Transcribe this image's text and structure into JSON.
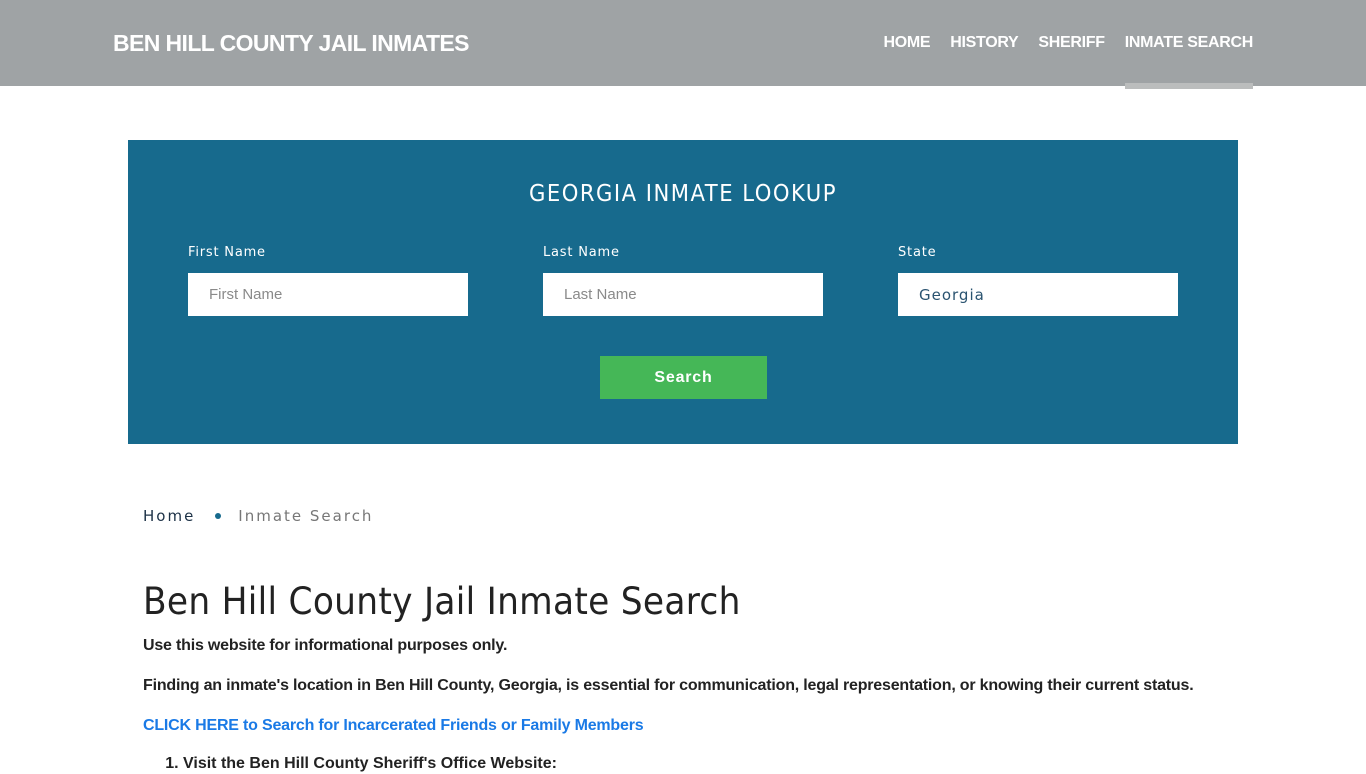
{
  "header": {
    "brand": "BEN HILL COUNTY JAIL INMATES",
    "nav": [
      {
        "label": "HOME",
        "active": false
      },
      {
        "label": "HISTORY",
        "active": false
      },
      {
        "label": "SHERIFF",
        "active": false
      },
      {
        "label": "INMATE SEARCH",
        "active": true
      }
    ],
    "colors": {
      "background": "#9fa3a5",
      "active_underline": "#bbbdbd"
    }
  },
  "lookup": {
    "title": "GEORGIA INMATE LOOKUP",
    "first_name": {
      "label": "First Name",
      "placeholder": "First Name",
      "value": ""
    },
    "last_name": {
      "label": "Last Name",
      "placeholder": "Last Name",
      "value": ""
    },
    "state": {
      "label": "State",
      "value": "Georgia"
    },
    "search_button": "Search",
    "colors": {
      "panel": "#176a8d",
      "button": "#45b757"
    }
  },
  "breadcrumb": {
    "items": [
      "Home",
      "Inmate Search"
    ]
  },
  "content": {
    "title": "Ben Hill County Jail Inmate Search",
    "paragraphs": [
      "Use this website for informational purposes only.",
      "Finding an inmate's location in Ben Hill County, Georgia, is essential for communication, legal representation, or knowing their current status."
    ],
    "cta_link": "CLICK HERE to Search for Incarcerated Friends or Family Members",
    "steps": [
      "Visit the Ben Hill County Sheriff's Office Website:"
    ],
    "colors": {
      "link": "#1a7ae6"
    }
  }
}
